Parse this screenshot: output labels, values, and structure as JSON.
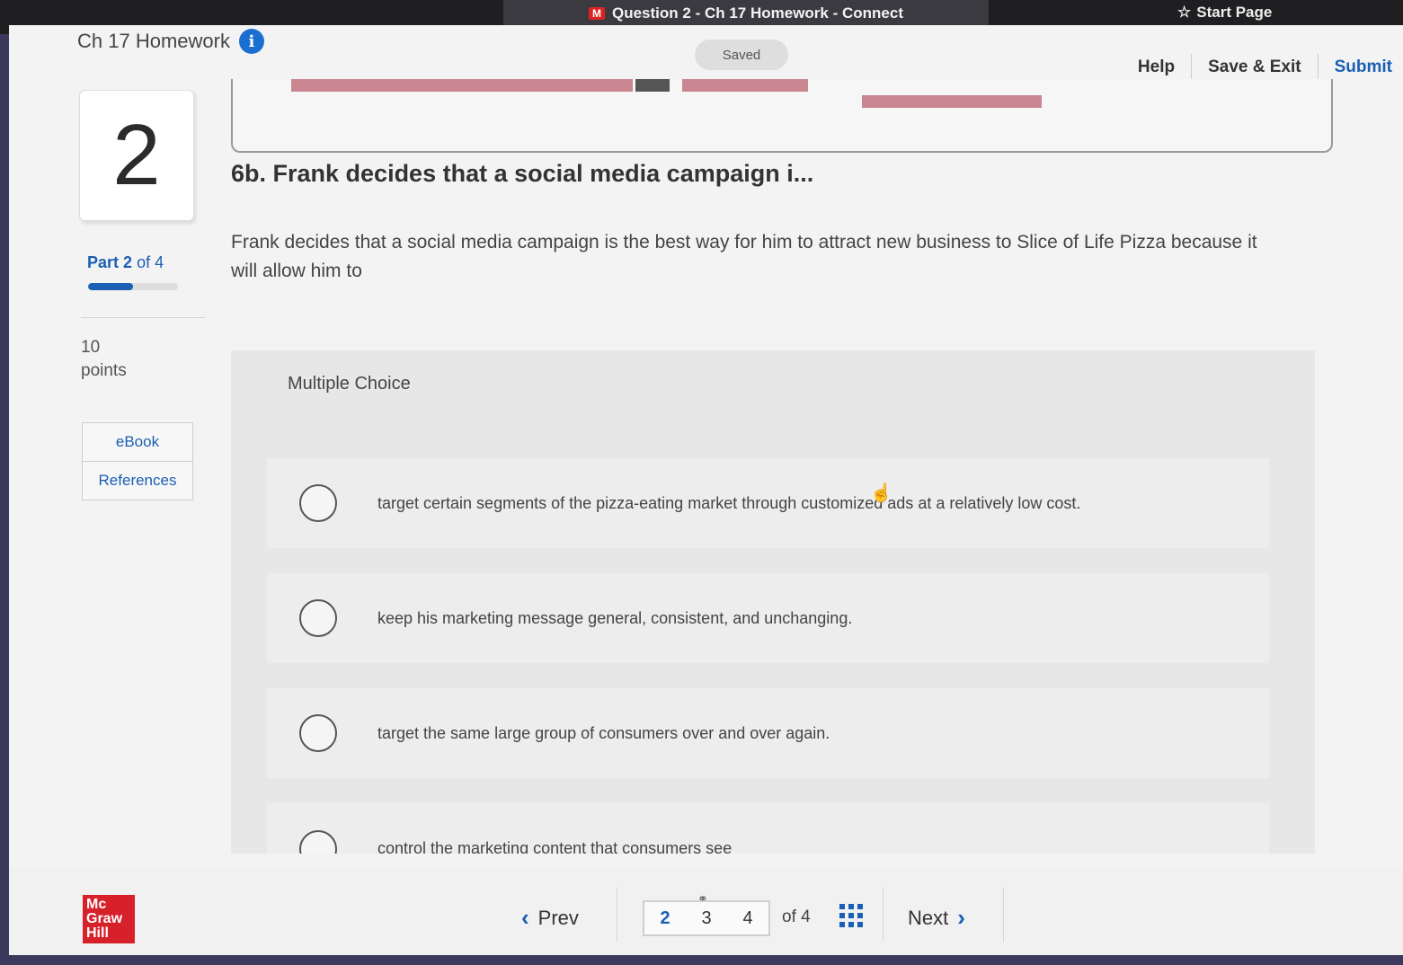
{
  "browser": {
    "tab_title": "Question 2 - Ch 17 Homework - Connect",
    "start_page_label": "Start Page"
  },
  "header": {
    "title": "Ch 17 Homework",
    "saved_label": "Saved",
    "help_label": "Help",
    "save_exit_label": "Save & Exit",
    "submit_label": "Submit"
  },
  "sidebar": {
    "question_number": "2",
    "part_prefix": "Part",
    "part_current": "2",
    "part_of": "of 4",
    "part_progress": 0.5,
    "points_value": "10",
    "points_label": "points",
    "resources": [
      "eBook",
      "References"
    ]
  },
  "question": {
    "title": "6b. Frank decides that a social media campaign i...",
    "body": "Frank decides that a social media campaign is the best way for him to attract new business to Slice of Life Pizza because it will allow him to"
  },
  "multiple_choice": {
    "label": "Multiple Choice",
    "options": [
      "target certain segments of the pizza-eating market through customized ads at a relatively low cost.",
      "keep his marketing message general, consistent, and unchanging.",
      "target the same large group of consumers over and over again.",
      "control the marketing content that consumers see"
    ]
  },
  "footer": {
    "logo_lines": [
      "Mc",
      "Graw",
      "Hill"
    ],
    "prev_label": "Prev",
    "pages": [
      "2",
      "3",
      "4"
    ],
    "current_page": "2",
    "of_total": "of 4",
    "next_label": "Next"
  }
}
